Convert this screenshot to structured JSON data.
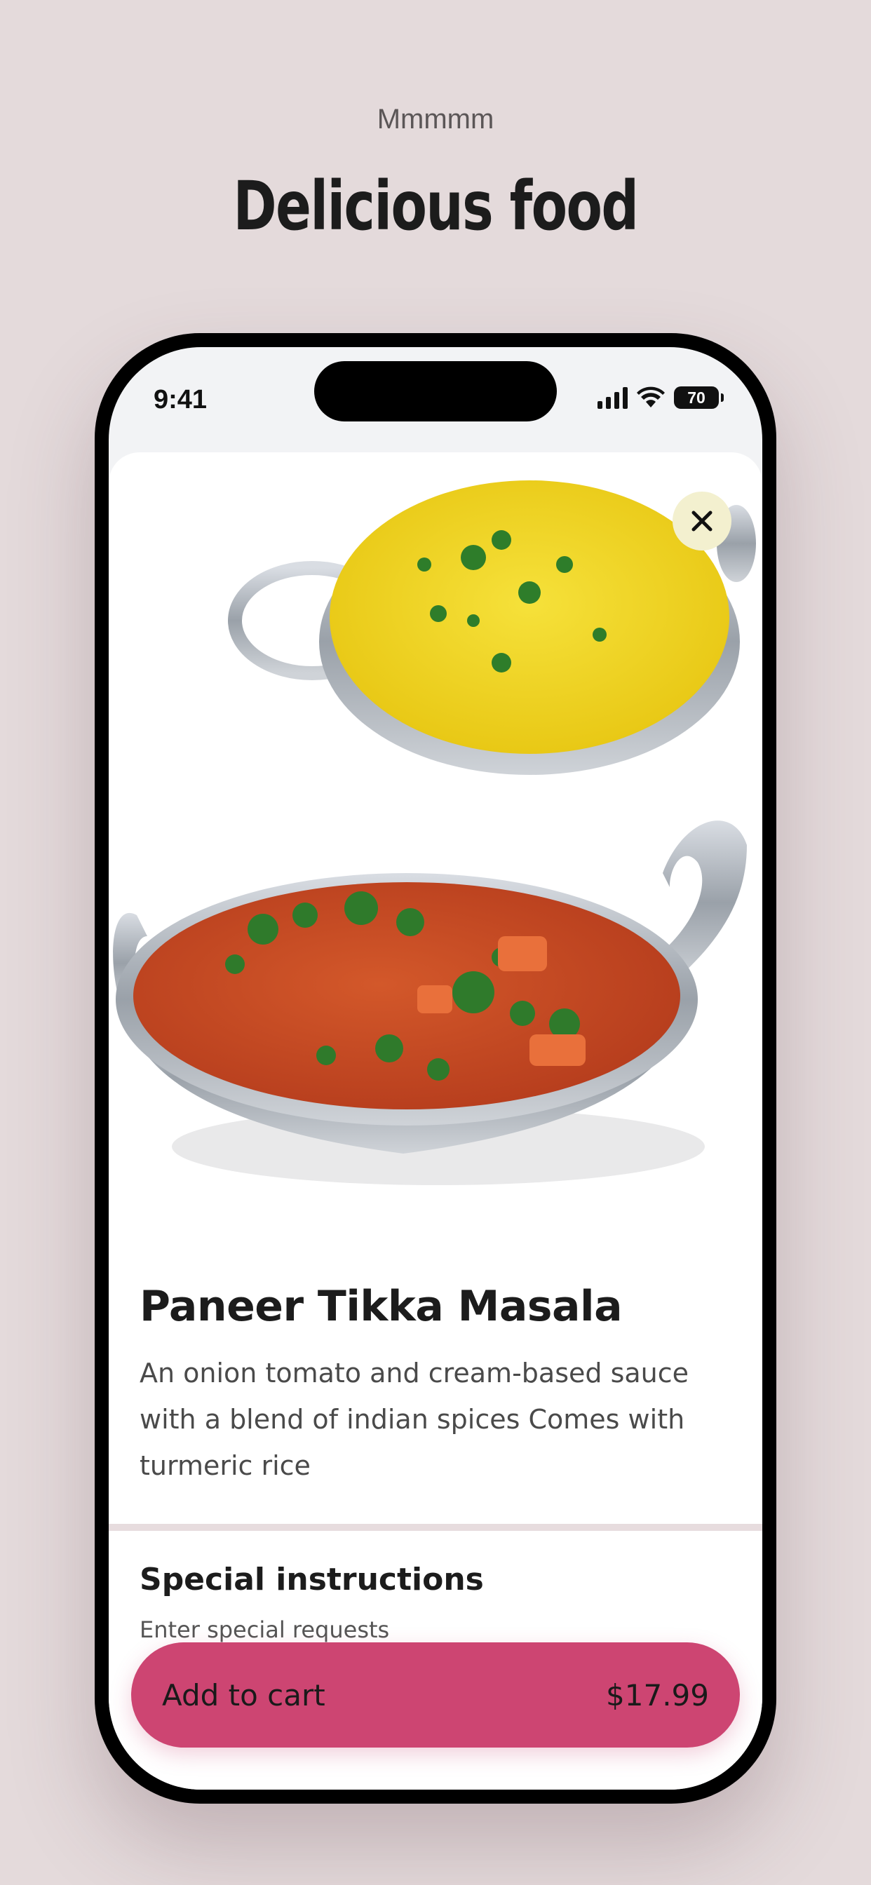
{
  "header": {
    "eyebrow": "Mmmmm",
    "headline": "Delicious food"
  },
  "status_bar": {
    "time": "9:41",
    "battery": "70",
    "icons": [
      "signal-icon",
      "wifi-icon",
      "battery-icon"
    ]
  },
  "item": {
    "close_icon": "close-icon",
    "image": "paneer-tikka-masala-with-turmeric-rice",
    "title": "Paneer Tikka Masala",
    "description": "An onion tomato and cream-based sauce with a blend of indian spices Comes with turmeric rice"
  },
  "special_instructions": {
    "title": "Special instructions",
    "placeholder": "Enter special requests"
  },
  "cart": {
    "label": "Add to cart",
    "price": "$17.99"
  },
  "colors": {
    "background": "#e4dadb",
    "accent": "#cd4572",
    "close_button": "#f3f0cf"
  }
}
